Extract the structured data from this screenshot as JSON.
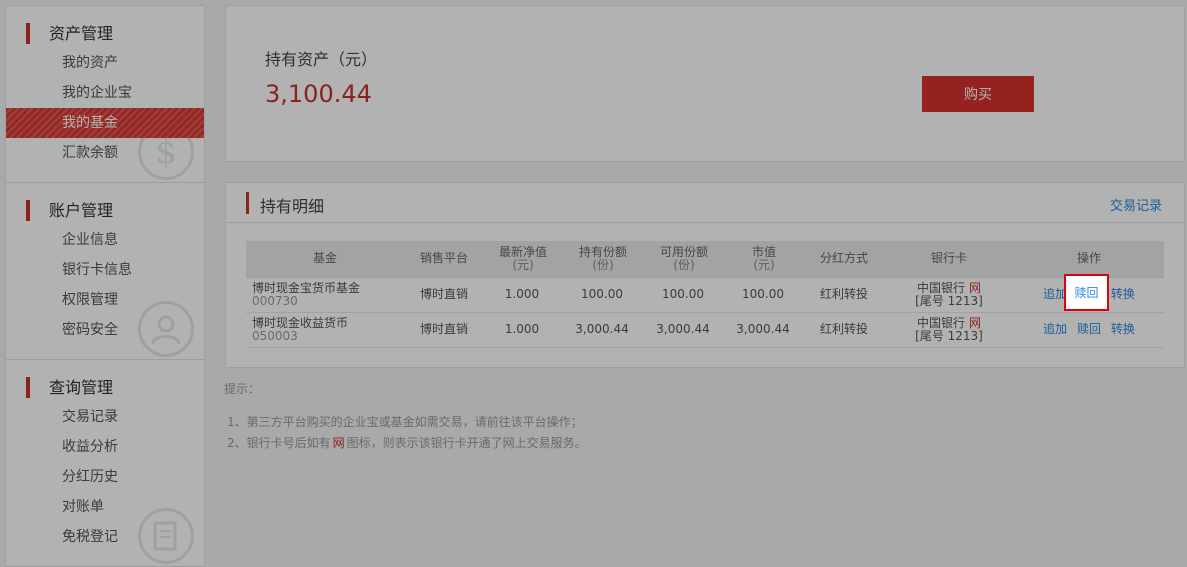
{
  "sidebar": {
    "groups": [
      {
        "title": "资产管理",
        "items": [
          {
            "label": "我的资产"
          },
          {
            "label": "我的企业宝"
          },
          {
            "label": "我的基金"
          },
          {
            "label": "汇款余额"
          }
        ]
      },
      {
        "title": "账户管理",
        "items": [
          {
            "label": "企业信息"
          },
          {
            "label": "银行卡信息"
          },
          {
            "label": "权限管理"
          },
          {
            "label": "密码安全"
          }
        ]
      },
      {
        "title": "查询管理",
        "items": [
          {
            "label": "交易记录"
          },
          {
            "label": "收益分析"
          },
          {
            "label": "分红历史"
          },
          {
            "label": "对账单"
          },
          {
            "label": "免税登记"
          }
        ]
      }
    ],
    "active_item": "我的基金",
    "watermarks": [
      "$"
    ]
  },
  "asset": {
    "label": "持有资产（元）",
    "value": "3,100.44",
    "buy_label": "购买"
  },
  "holdings": {
    "title": "持有明细",
    "tx_link": "交易记录",
    "headers": {
      "fund": "基金",
      "platform": "销售平台",
      "nav": "最新净值",
      "nav_unit": "(元)",
      "held": "持有份额",
      "held_unit": "(份)",
      "available": "可用份额",
      "available_unit": "(份)",
      "market": "市值",
      "market_unit": "(元)",
      "dividend": "分红方式",
      "bank": "银行卡",
      "ops": "操作"
    },
    "rows": [
      {
        "fund_name": "博时现金宝货币基金",
        "fund_code": "000730",
        "platform": "博时直销",
        "nav": "1.000",
        "held": "100.00",
        "available": "100.00",
        "market": "100.00",
        "dividend": "红利转投",
        "bank_name": "中国银行",
        "bank_tail": "[尾号 1213]",
        "wang": "网",
        "op_add": "追加",
        "op_redeem": "赎回",
        "op_convert": "转换"
      },
      {
        "fund_name": "博时现金收益货币",
        "fund_code": "050003",
        "platform": "博时直销",
        "nav": "1.000",
        "held": "3,000.44",
        "available": "3,000.44",
        "market": "3,000.44",
        "dividend": "红利转投",
        "bank_name": "中国银行",
        "bank_tail": "[尾号 1213]",
        "wang": "网",
        "op_add": "追加",
        "op_redeem": "赎回",
        "op_convert": "转换"
      }
    ]
  },
  "tips": {
    "title": "提示：",
    "line1": "1、第三方平台购买的企业宝或基金如需交易，请前往该平台操作；",
    "line2_pre": "2、银行卡号后如有",
    "line2_icon": "网",
    "line2_post": "图标，则表示该银行卡开通了网上交易服务。"
  },
  "colors": {
    "accent": "#c9312a",
    "link": "#2d86d9",
    "highlight": "#e0000a"
  }
}
